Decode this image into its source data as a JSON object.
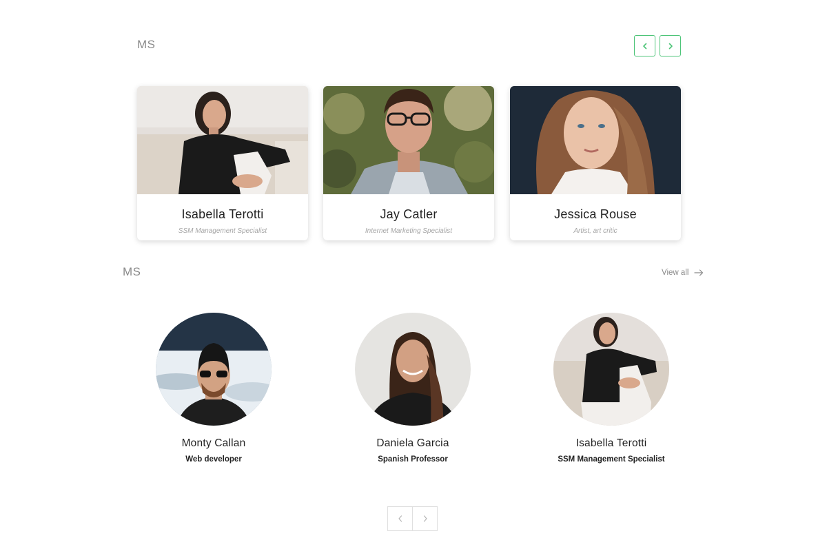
{
  "section1": {
    "title": "MS",
    "prev_icon": "chevron-left-icon",
    "next_icon": "chevron-right-icon",
    "accent": "#4cc477",
    "cards": [
      {
        "name": "Isabella Terotti",
        "role": "SSM Management Specialist"
      },
      {
        "name": "Jay Catler",
        "role": "Internet Marketing Specialist"
      },
      {
        "name": "Jessica Rouse",
        "role": "Artist, art critic"
      }
    ]
  },
  "section2": {
    "title": "MS",
    "view_all": "View all",
    "view_all_icon": "arrow-right-icon",
    "people": [
      {
        "name": "Monty Callan",
        "role": "Web developer"
      },
      {
        "name": "Daniela Garcia",
        "role": "Spanish Professor"
      },
      {
        "name": "Isabella Terotti",
        "role": "SSM Management Specialist"
      }
    ]
  },
  "pager": {
    "prev_icon": "chevron-left-icon",
    "next_icon": "chevron-right-icon"
  }
}
